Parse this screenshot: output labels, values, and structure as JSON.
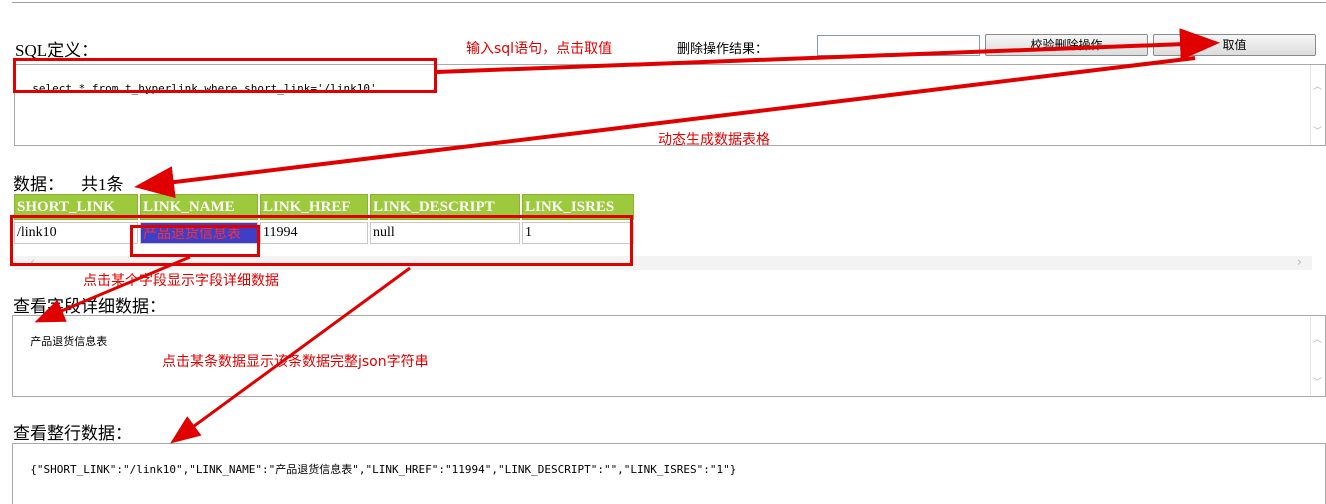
{
  "sql_section": {
    "label": "SQL定义：",
    "query": "select * from t_hyperlink where short_link='/link10'"
  },
  "delete_section": {
    "label": "删除操作结果：",
    "result_value": "",
    "verify_button": "校验删除操作",
    "fetch_button": "取值"
  },
  "data_section": {
    "label": "数据：",
    "count": "共1条",
    "columns": [
      "SHORT_LINK",
      "LINK_NAME",
      "LINK_HREF",
      "LINK_DESCRIPT",
      "LINK_ISRES"
    ],
    "rows": [
      [
        "/link10",
        "产品退货信息表",
        "11994",
        "null",
        "1"
      ]
    ]
  },
  "field_detail": {
    "label": "查看字段详细数据：",
    "value": "产品退货信息表"
  },
  "row_detail": {
    "label": "查看整行数据：",
    "value": "{\"SHORT_LINK\":\"/link10\",\"LINK_NAME\":\"产品退货信息表\",\"LINK_HREF\":\"11994\",\"LINK_DESCRIPT\":\"\",\"LINK_ISRES\":\"1\"}"
  },
  "annotations": {
    "input_sql": "输入sql语句，点击取值",
    "dynamic_table": "动态生成数据表格",
    "click_field": "点击某个字段显示字段详细数据",
    "click_row": "点击某条数据显示该条数据完整json字符串"
  },
  "colors": {
    "annotation": "#e00000",
    "header_bg": "#9dc93c",
    "selected_cell_bg": "#3e3ec8"
  }
}
